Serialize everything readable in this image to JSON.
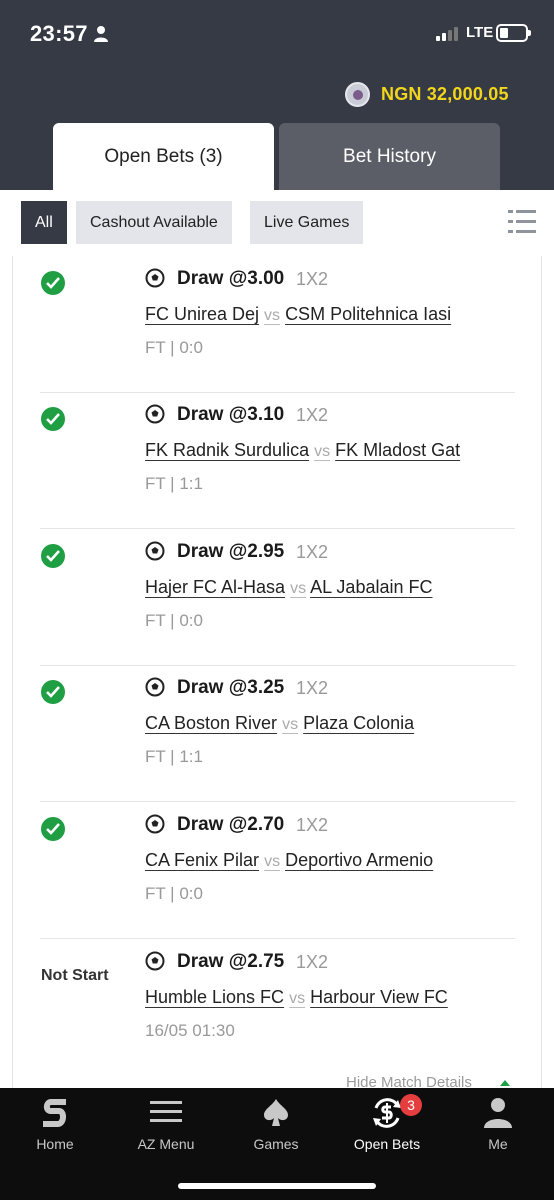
{
  "status_bar": {
    "time": "23:57",
    "network": "LTE"
  },
  "header": {
    "balance": "NGN 32,000.05",
    "tabs": [
      {
        "label": "Open Bets (3)",
        "active": true
      },
      {
        "label": "Bet History",
        "active": false
      }
    ]
  },
  "filters": [
    {
      "label": "All",
      "active": true
    },
    {
      "label": "Cashout Available",
      "active": false
    },
    {
      "label": "Live Games",
      "active": false
    }
  ],
  "bets": [
    {
      "status": "won",
      "status_label": "",
      "pick": "Draw @3.00",
      "market": "1X2",
      "home": "FC Unirea Dej",
      "vs": "vs",
      "away": "CSM Politehnica Iasi",
      "result": "FT | 0:0"
    },
    {
      "status": "won",
      "status_label": "",
      "pick": "Draw @3.10",
      "market": "1X2",
      "home": "FK Radnik Surdulica",
      "vs": "vs",
      "away": "FK Mladost Gat",
      "result": "FT | 1:1"
    },
    {
      "status": "won",
      "status_label": "",
      "pick": "Draw @2.95",
      "market": "1X2",
      "home": "Hajer FC Al-Hasa",
      "vs": "vs",
      "away": "AL Jabalain FC",
      "result": "FT | 0:0"
    },
    {
      "status": "won",
      "status_label": "",
      "pick": "Draw @3.25",
      "market": "1X2",
      "home": "CA Boston River",
      "vs": "vs",
      "away": "Plaza Colonia",
      "result": "FT | 1:1"
    },
    {
      "status": "won",
      "status_label": "",
      "pick": "Draw @2.70",
      "market": "1X2",
      "home": "CA Fenix Pilar",
      "vs": "vs",
      "away": "Deportivo Armenio",
      "result": "FT | 0:0"
    },
    {
      "status": "pending",
      "status_label": "Not Start",
      "pick": "Draw @2.75",
      "market": "1X2",
      "home": "Humble Lions FC",
      "vs": "vs",
      "away": "Harbour View FC",
      "result": "16/05 01:30"
    }
  ],
  "hide_details_label": "Hide Match Details",
  "bottom_nav": {
    "items": [
      {
        "label": "Home",
        "icon": "sportybet-logo-icon"
      },
      {
        "label": "AZ Menu",
        "icon": "hamburger-menu-icon"
      },
      {
        "label": "Games",
        "icon": "spade-icon"
      },
      {
        "label": "Open Bets",
        "icon": "open-bets-icon",
        "active": true,
        "badge": "3"
      },
      {
        "label": "Me",
        "icon": "person-icon"
      }
    ]
  },
  "colors": {
    "header_bg": "#353a45",
    "balance": "#f2d61c",
    "won": "#1f9e43",
    "badge": "#e63e3e"
  }
}
